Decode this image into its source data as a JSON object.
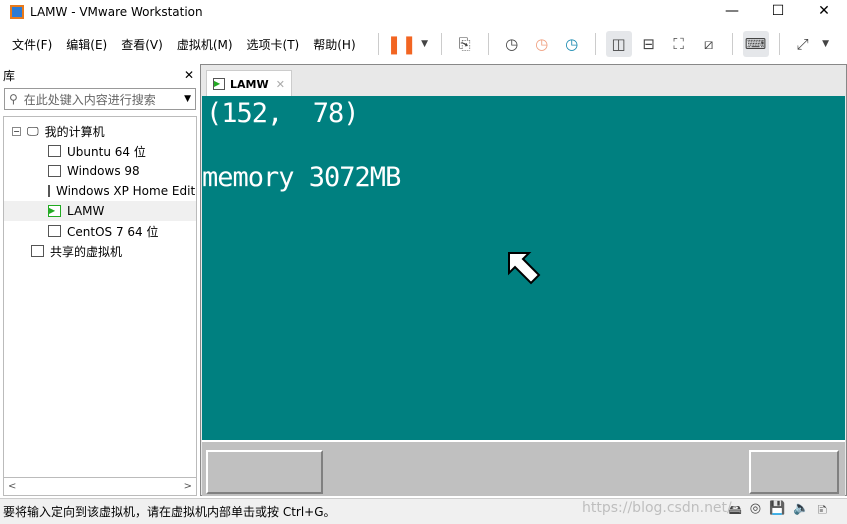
{
  "window": {
    "title": "LAMW - VMware Workstation",
    "minimize": "—",
    "maximize": "☐",
    "close": "✕"
  },
  "menu": [
    "文件(F)",
    "编辑(E)",
    "查看(V)",
    "虚拟机(M)",
    "选项卡(T)",
    "帮助(H)"
  ],
  "library": {
    "title": "库",
    "close": "✕",
    "search_placeholder": "在此处键入内容进行搜索",
    "tree": {
      "root": "我的计算机",
      "vms": [
        "Ubuntu 64 位",
        "Windows 98",
        "Windows XP Home Edition",
        "LAMW",
        "CentOS 7 64 位"
      ],
      "shared": "共享的虚拟机"
    }
  },
  "tab": {
    "label": "LAMW",
    "close": "✕"
  },
  "guest": {
    "line1": "(152,  78)",
    "line2": "memory 3072MB"
  },
  "status": {
    "text": "要将输入定向到该虚拟机，请在虚拟机内部单击或按 Ctrl+G。",
    "watermark": "https://blog.csdn.net/"
  },
  "colors": {
    "guest_bg": "#008080",
    "pause": "#f26522"
  }
}
